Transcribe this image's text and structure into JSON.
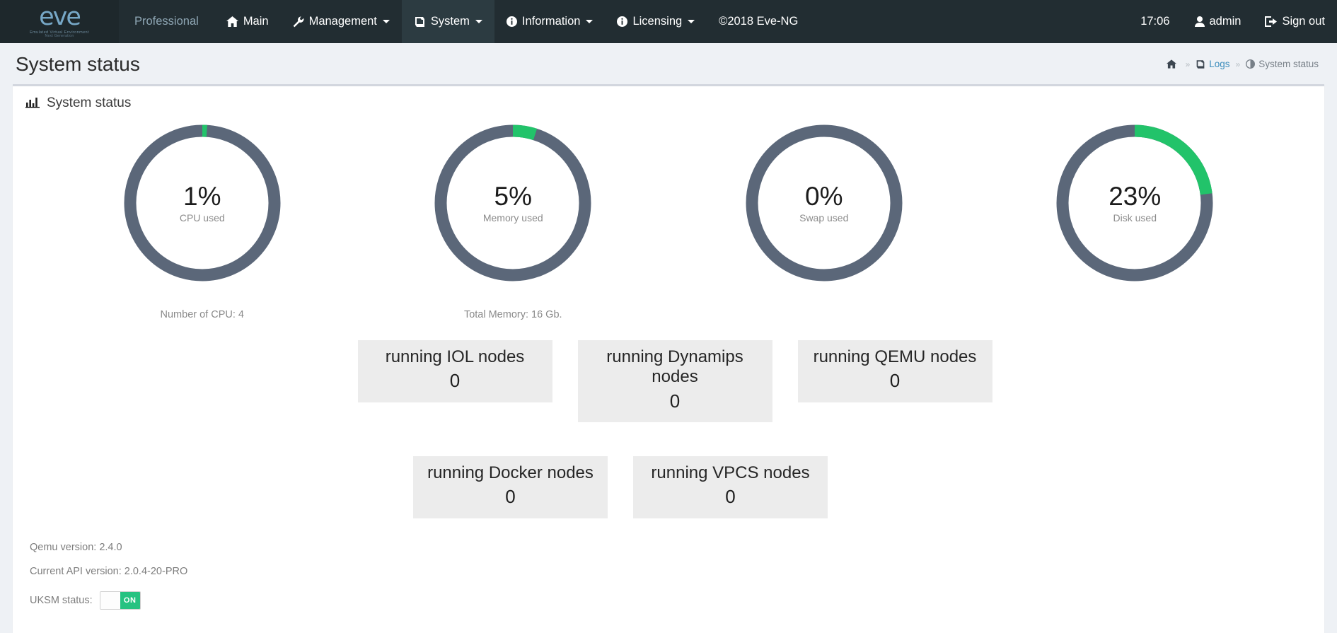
{
  "navbar": {
    "brand": {
      "logo_text": "eve",
      "sub1": "Emulated Virtual Environment",
      "sub2": "Next Generation"
    },
    "edition": "Professional",
    "items": [
      {
        "label": "Main",
        "icon": "home-icon",
        "caret": false,
        "active": false
      },
      {
        "label": "Management",
        "icon": "wrench-icon",
        "caret": true,
        "active": false
      },
      {
        "label": "System",
        "icon": "book-icon",
        "caret": true,
        "active": true
      },
      {
        "label": "Information",
        "icon": "info-circle-icon",
        "caret": true,
        "active": false
      },
      {
        "label": "Licensing",
        "icon": "info-circle-icon",
        "caret": true,
        "active": false
      }
    ],
    "copyright": "©2018 Eve-NG",
    "time": "17:06",
    "user": "admin",
    "signout": "Sign out"
  },
  "header": {
    "title": "System status",
    "breadcrumb": [
      {
        "label": "",
        "icon": "home-icon",
        "active": false
      },
      {
        "label": "Logs",
        "icon": "book-icon",
        "active": false
      },
      {
        "label": "System status",
        "icon": "contrast-circle-icon",
        "active": true
      }
    ],
    "separator": "»"
  },
  "box": {
    "title": "System status",
    "icon": "bar-chart-icon"
  },
  "chart_data": {
    "type": "pie",
    "title": "System status",
    "donuts": [
      {
        "name": "cpu",
        "value": 1,
        "display": "1%",
        "label": "CPU used",
        "caption": "Number of CPU: 4",
        "track_color": "#5b6779",
        "fill_color": "#22c36a"
      },
      {
        "name": "memory",
        "value": 5,
        "display": "5%",
        "label": "Memory used",
        "caption": "Total Memory: 16 Gb.",
        "track_color": "#5b6779",
        "fill_color": "#22c36a"
      },
      {
        "name": "swap",
        "value": 0,
        "display": "0%",
        "label": "Swap used",
        "caption": "",
        "track_color": "#5b6779",
        "fill_color": "#22c36a"
      },
      {
        "name": "disk",
        "value": 23,
        "display": "23%",
        "label": "Disk used",
        "caption": "",
        "track_color": "#5b6779",
        "fill_color": "#22c36a"
      }
    ],
    "ylim": [
      0,
      100
    ]
  },
  "nodes": {
    "row1": [
      {
        "title": "running IOL nodes",
        "value": "0"
      },
      {
        "title": "running Dynamips nodes",
        "value": "0"
      },
      {
        "title": "running QEMU nodes",
        "value": "0"
      }
    ],
    "row2": [
      {
        "title": "running Docker nodes",
        "value": "0"
      },
      {
        "title": "running VPCS nodes",
        "value": "0"
      }
    ]
  },
  "sysinfo": {
    "qemu": "Qemu version: 2.4.0",
    "api": "Current API version: 2.0.4-20-PRO",
    "uksm_label": "UKSM status:",
    "uksm_state": "ON"
  },
  "colors": {
    "navbar_bg": "#222d32",
    "brand_bg": "#1e282c",
    "page_bg": "#eef1f5",
    "accent_green": "#22c36a",
    "donut_track": "#5b6779",
    "link_blue": "#3c8dbc"
  }
}
